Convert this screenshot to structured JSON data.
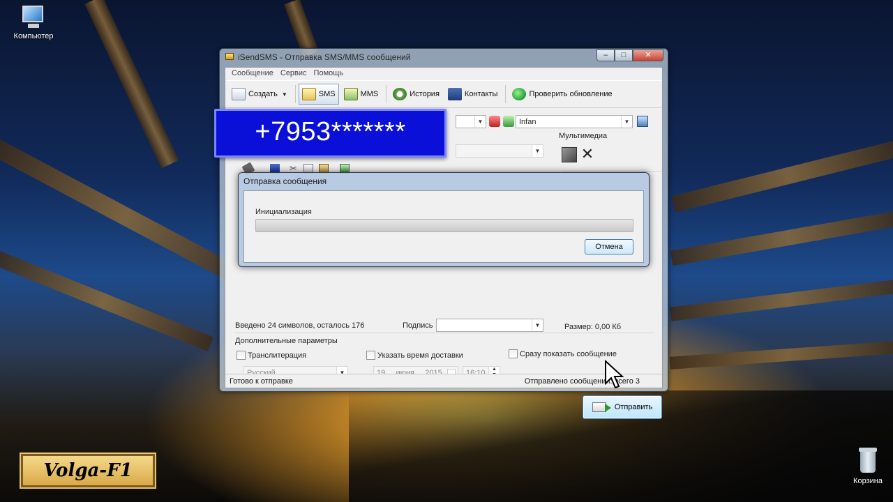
{
  "desktop": {
    "computer_label": "Компьютер",
    "trash_label": "Корзина",
    "logo_text": "Volga-F1"
  },
  "window": {
    "title": "iSendSMS - Отправка SMS/MMS сообщений",
    "minimize": "–",
    "maximize": "□",
    "close": "✕"
  },
  "menu": [
    "Сообщение",
    "Сервис",
    "Помощь"
  ],
  "toolbar": {
    "create": "Создать",
    "sms": "SMS",
    "mms": "MMS",
    "history": "История",
    "contacts": "Контакты",
    "update": "Проверить обновление"
  },
  "form": {
    "operator_value": "Infan",
    "multimedia_label": "Мультимедиа",
    "chars_info": "Введено 24 символов, осталось 176",
    "signature_label": "Подпись",
    "signature_value": "",
    "extra_params_label": "Дополнительные параметры",
    "translit_label": "Транслитерация",
    "language_value": "Русский",
    "delivery_time_label": "Указать время доставки",
    "date_day": "19",
    "date_month": "июня",
    "date_year": "2015",
    "time_value": "16:10",
    "show_now_label": "Сразу показать сообщение",
    "size_label": "Размер: 0,00 Кб",
    "send_button": "Отправить"
  },
  "status": {
    "left": "Готово к отправке",
    "right": "Отправлено сообщений: всего 3"
  },
  "phone_banner": "+7953*******",
  "dialog": {
    "title": "Отправка сообщения",
    "status_text": "Инициализация",
    "progress": 0,
    "cancel_button": "Отмена"
  }
}
